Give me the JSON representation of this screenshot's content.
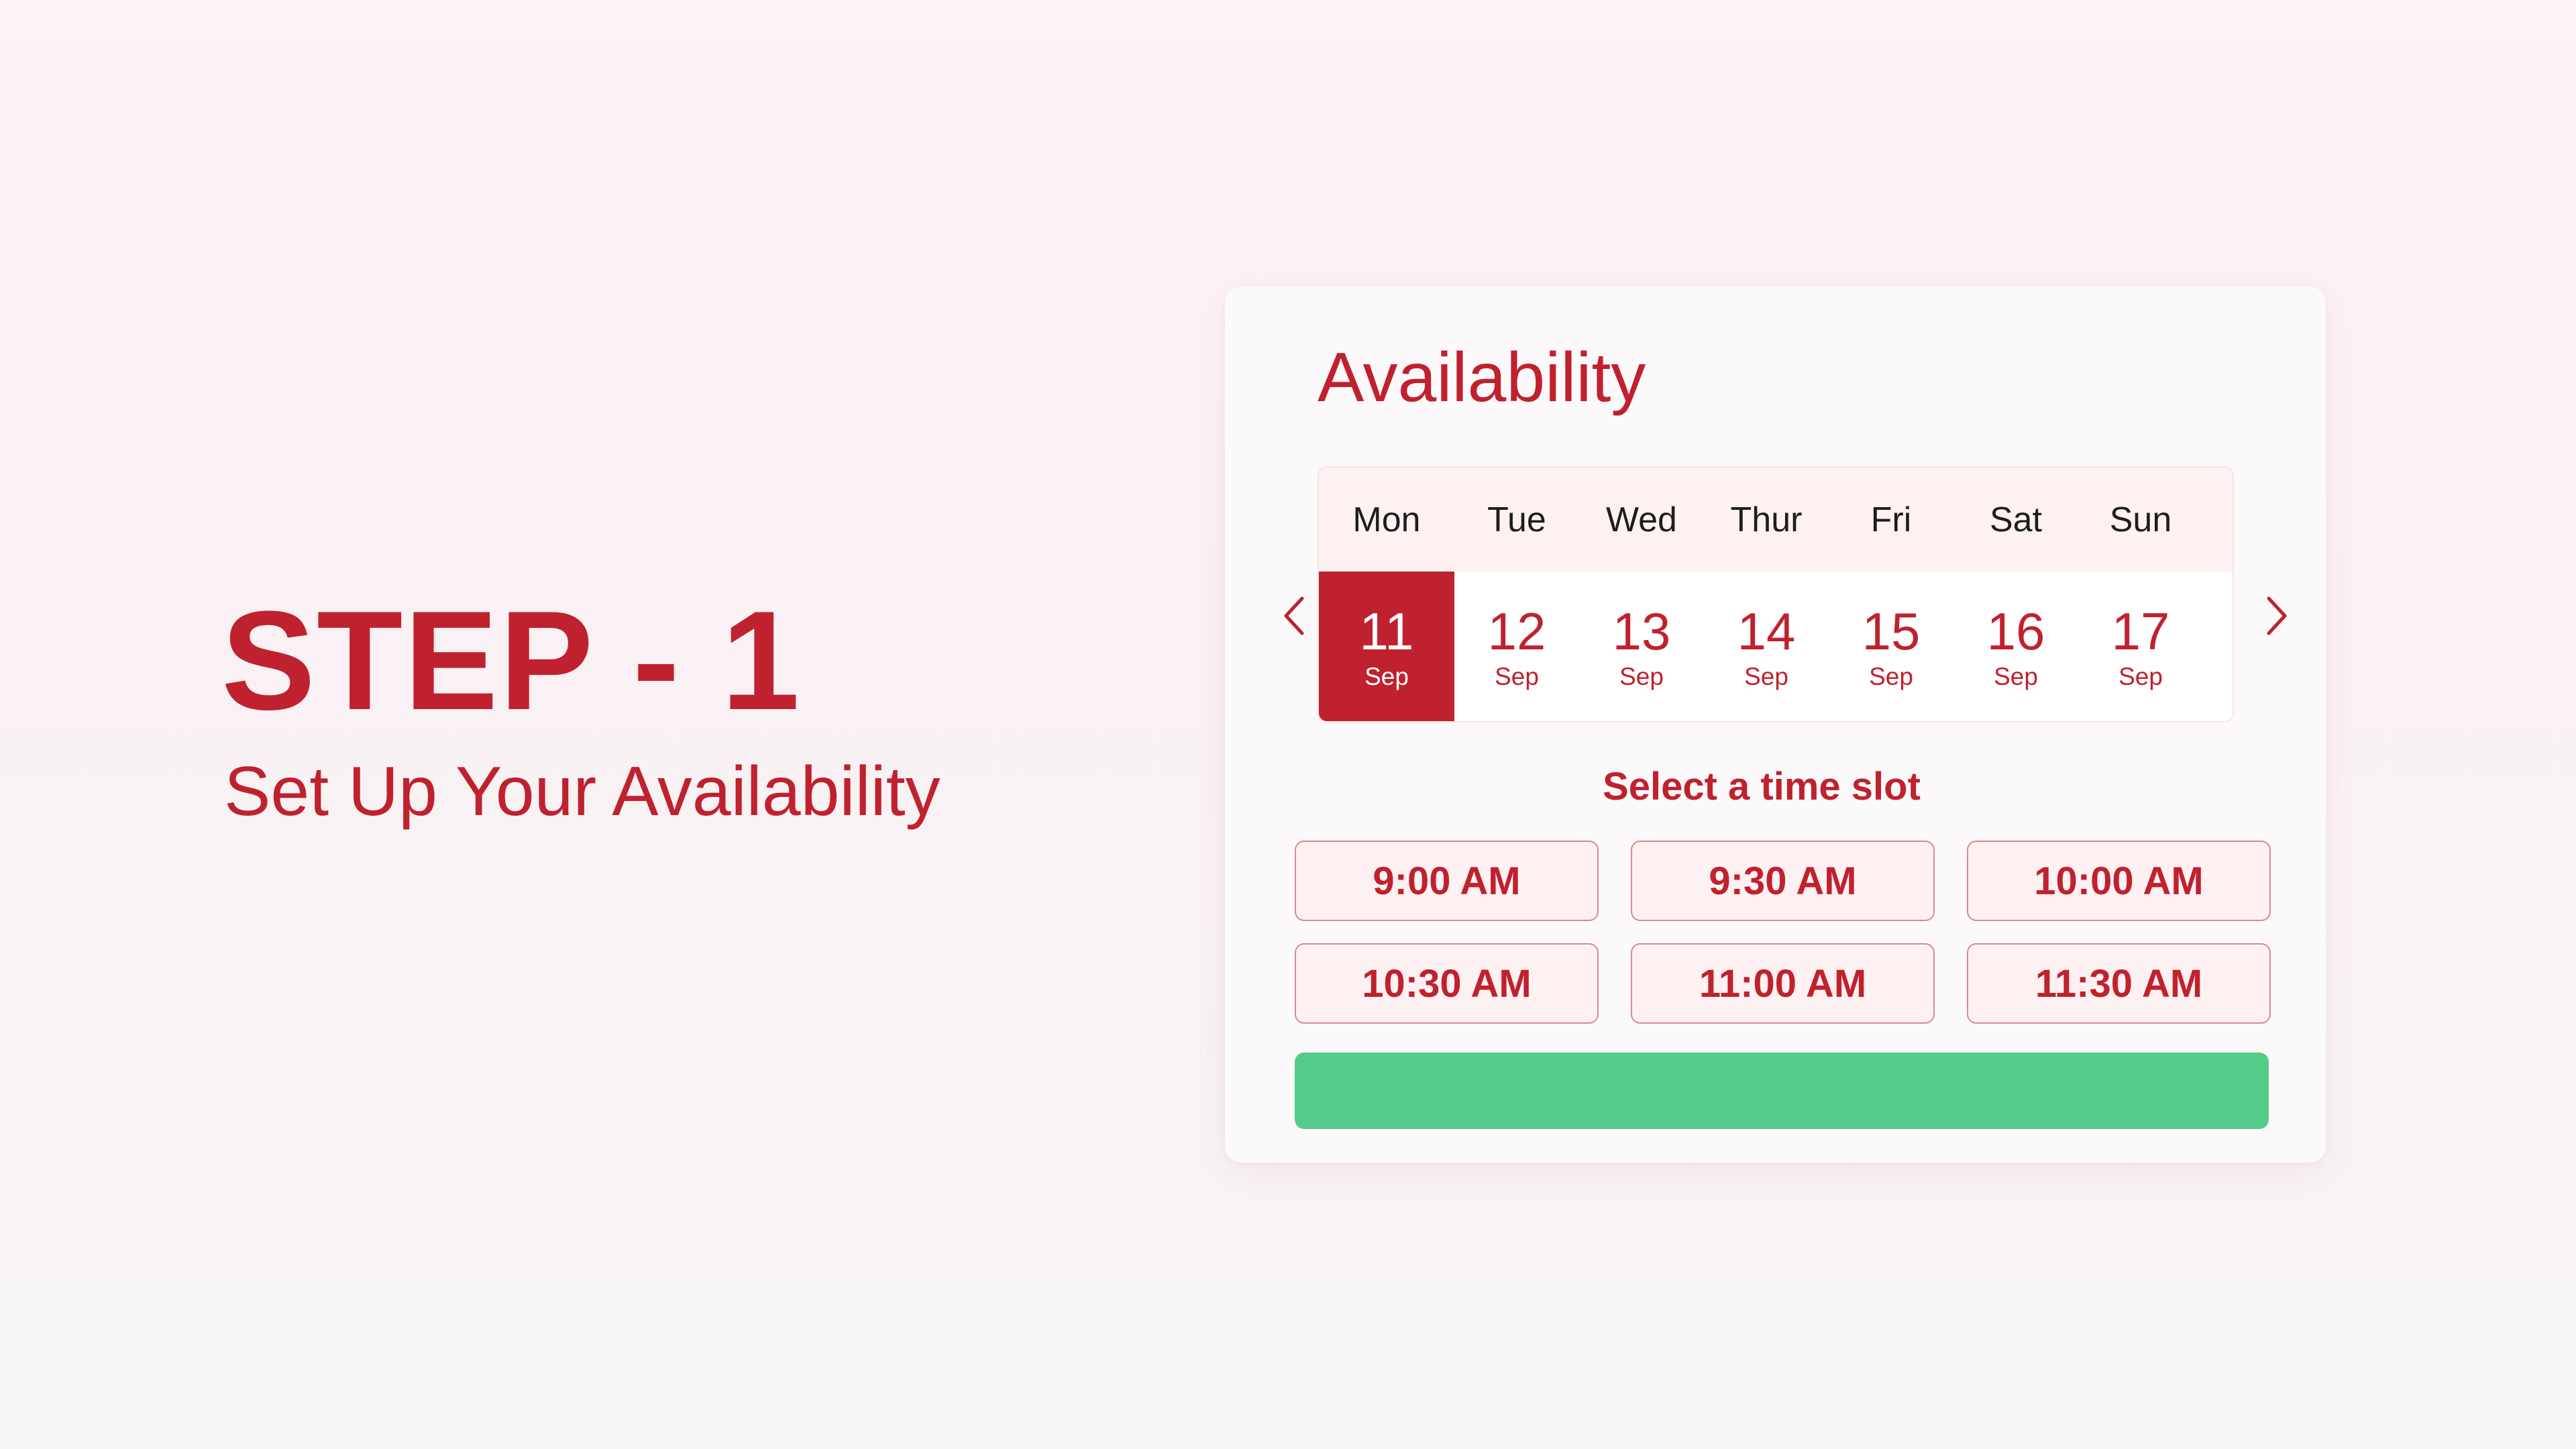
{
  "step": {
    "title": "STEP - 1",
    "subtitle": "Set Up Your Availability"
  },
  "card": {
    "title": "Availability",
    "prev_icon": "chevron-left-icon",
    "next_icon": "chevron-right-icon",
    "days": [
      {
        "name": "Mon",
        "date": "11",
        "month": "Sep",
        "selected": true
      },
      {
        "name": "Tue",
        "date": "12",
        "month": "Sep",
        "selected": false
      },
      {
        "name": "Wed",
        "date": "13",
        "month": "Sep",
        "selected": false
      },
      {
        "name": "Thur",
        "date": "14",
        "month": "Sep",
        "selected": false
      },
      {
        "name": "Fri",
        "date": "15",
        "month": "Sep",
        "selected": false
      },
      {
        "name": "Sat",
        "date": "16",
        "month": "Sep",
        "selected": false
      },
      {
        "name": "Sun",
        "date": "17",
        "month": "Sep",
        "selected": false
      }
    ],
    "slot_heading": "Select a time slot",
    "slots": [
      "9:00 AM",
      "9:30 AM",
      "10:00 AM",
      "10:30 AM",
      "11:00 AM",
      "11:30 AM"
    ],
    "confirm_label": ""
  },
  "colors": {
    "accent": "#c0212f",
    "selected_bg": "#c0212f",
    "slot_bg": "#fdf1f1",
    "slot_border": "#d88a92",
    "confirm": "#55cb89",
    "header_bg": "#fdf1f1"
  }
}
